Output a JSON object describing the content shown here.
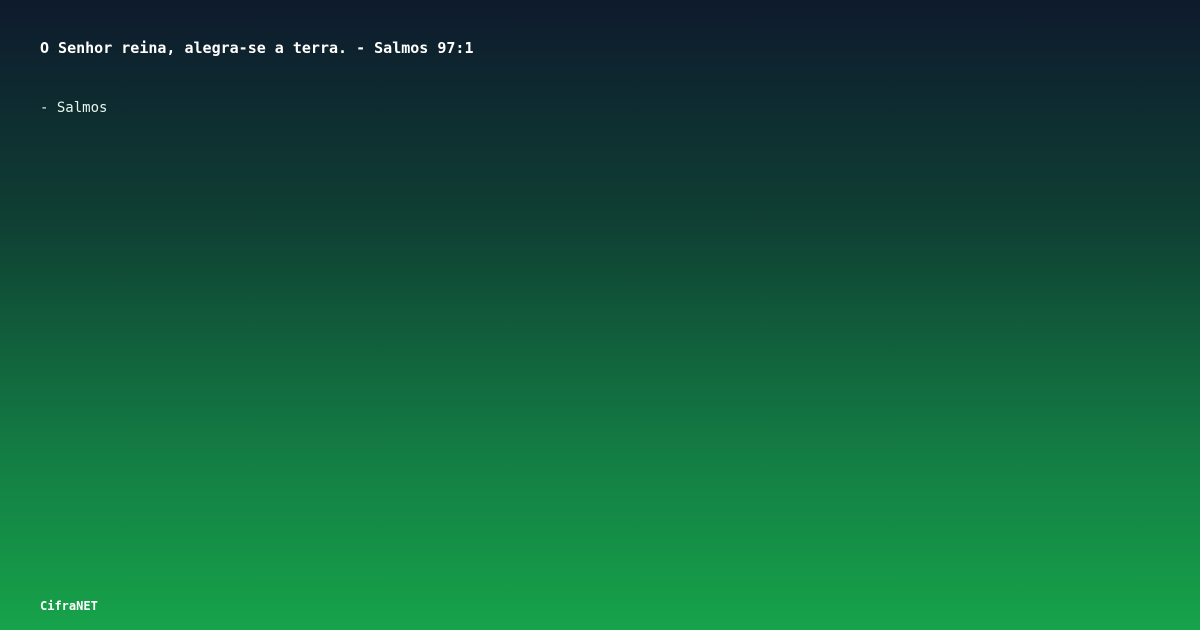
{
  "quote": {
    "text": "O Senhor reina, alegra-se a terra. - Salmos 97:1"
  },
  "author": {
    "text": "- Salmos"
  },
  "brand": {
    "name": "CifraNET"
  }
}
